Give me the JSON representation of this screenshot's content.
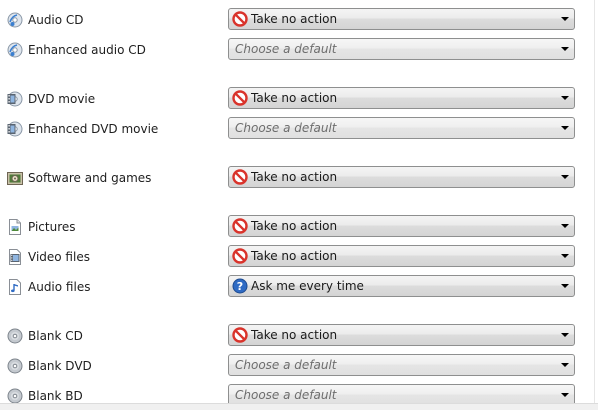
{
  "rows": [
    {
      "label": "Audio CD",
      "icon": "audio-cd-icon",
      "value": "Take no action",
      "value_icon": "no-action-icon",
      "placeholder": false
    },
    {
      "label": "Enhanced audio CD",
      "icon": "enhanced-audio-cd-icon",
      "value": "Choose a default",
      "value_icon": "",
      "placeholder": true
    },
    {
      "label": "DVD movie",
      "icon": "dvd-movie-icon",
      "value": "Take no action",
      "value_icon": "no-action-icon",
      "placeholder": false
    },
    {
      "label": "Enhanced DVD movie",
      "icon": "enhanced-dvd-movie-icon",
      "value": "Choose a default",
      "value_icon": "",
      "placeholder": true
    },
    {
      "label": "Software and games",
      "icon": "software-games-icon",
      "value": "Take no action",
      "value_icon": "no-action-icon",
      "placeholder": false
    },
    {
      "label": "Pictures",
      "icon": "pictures-icon",
      "value": "Take no action",
      "value_icon": "no-action-icon",
      "placeholder": false
    },
    {
      "label": "Video files",
      "icon": "video-files-icon",
      "value": "Take no action",
      "value_icon": "no-action-icon",
      "placeholder": false
    },
    {
      "label": "Audio files",
      "icon": "audio-files-icon",
      "value": "Ask me every time",
      "value_icon": "question-icon",
      "placeholder": false
    },
    {
      "label": "Blank CD",
      "icon": "blank-cd-icon",
      "value": "Take no action",
      "value_icon": "no-action-icon",
      "placeholder": false
    },
    {
      "label": "Blank DVD",
      "icon": "blank-dvd-icon",
      "value": "Choose a default",
      "value_icon": "",
      "placeholder": true
    },
    {
      "label": "Blank BD",
      "icon": "blank-bd-icon",
      "value": "Choose a default",
      "value_icon": "",
      "placeholder": true
    }
  ],
  "colors": {
    "no_action_red": "#d9332b",
    "question_blue": "#2f6bc4",
    "disc_blue": "#3a7fd0"
  }
}
